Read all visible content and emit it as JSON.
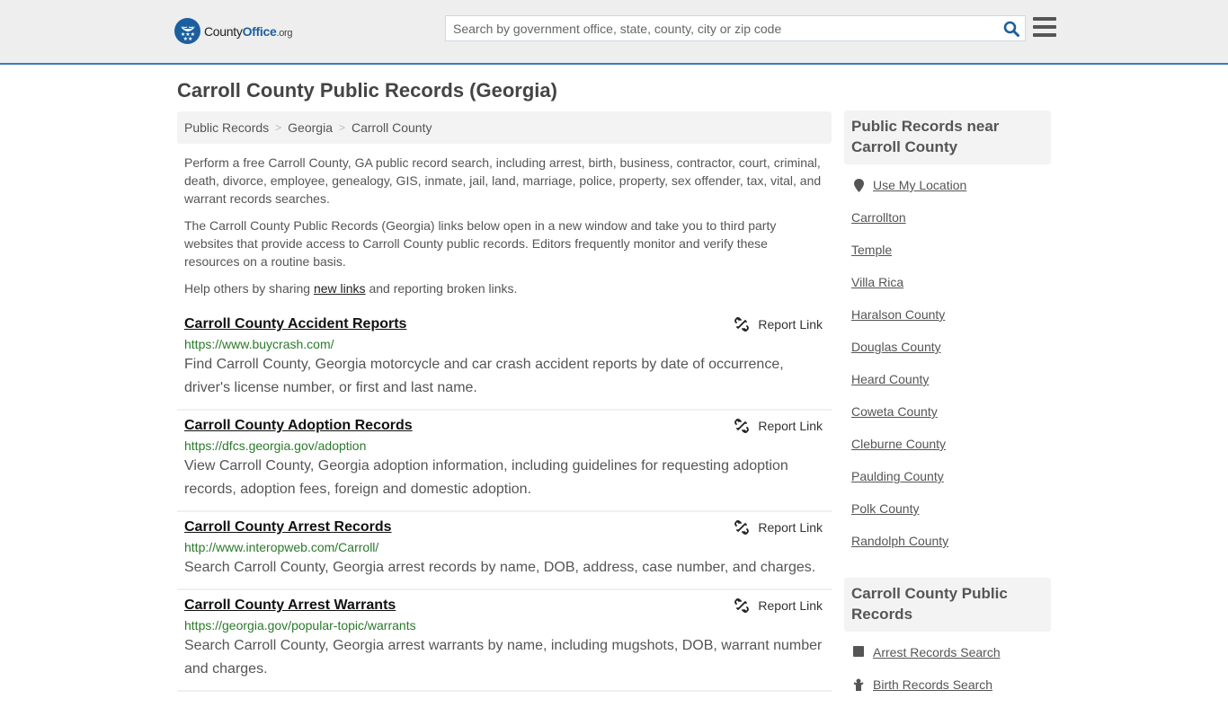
{
  "header": {
    "logo": {
      "county": "County",
      "office": "Office",
      "org": ".org"
    },
    "search": {
      "placeholder": "Search by government office, state, county, city or zip code",
      "value": ""
    },
    "brand_color": "#1b5f9e",
    "accent_line_color": "#3a7db4"
  },
  "page": {
    "title": "Carroll County Public Records (Georgia)"
  },
  "breadcrumb": [
    {
      "label": "Public Records"
    },
    {
      "label": "Georgia"
    },
    {
      "label": "Carroll County"
    }
  ],
  "breadcrumb_separator": ">",
  "intro": {
    "p1": "Perform a free Carroll County, GA public record search, including arrest, birth, business, contractor, court, criminal, death, divorce, employee, genealogy, GIS, inmate, jail, land, marriage, police, property, sex offender, tax, vital, and warrant records searches.",
    "p2": "The Carroll County Public Records (Georgia) links below open in a new window and take you to third party websites that provide access to Carroll County public records. Editors frequently monitor and verify these resources on a routine basis.",
    "p3_before": "Help others by sharing ",
    "p3_link": "new links",
    "p3_after": " and reporting broken links."
  },
  "report_label": "Report Link",
  "records": [
    {
      "title": "Carroll County Accident Reports",
      "url": "https://www.buycrash.com/",
      "description": "Find Carroll County, Georgia motorcycle and car crash accident reports by date of occurrence, driver's license number, or first and last name."
    },
    {
      "title": "Carroll County Adoption Records",
      "url": "https://dfcs.georgia.gov/adoption",
      "description": "View Carroll County, Georgia adoption information, including guidelines for requesting adoption records, adoption fees, foreign and domestic adoption."
    },
    {
      "title": "Carroll County Arrest Records",
      "url": "http://www.interopweb.com/Carroll/",
      "description": "Search Carroll County, Georgia arrest records by name, DOB, address, case number, and charges."
    },
    {
      "title": "Carroll County Arrest Warrants",
      "url": "https://georgia.gov/popular-topic/warrants",
      "description": "Search Carroll County, Georgia arrest warrants by name, including mugshots, DOB, warrant number and charges."
    }
  ],
  "sidebar": {
    "nearby_heading": "Public Records near Carroll County",
    "use_location": "Use My Location",
    "nearby": [
      "Carrollton",
      "Temple",
      "Villa Rica",
      "Haralson County",
      "Douglas County",
      "Heard County",
      "Coweta County",
      "Cleburne County",
      "Paulding County",
      "Polk County",
      "Randolph County"
    ],
    "records_heading": "Carroll County Public Records",
    "record_links": [
      {
        "label": "Arrest Records Search",
        "icon": "square-icon"
      },
      {
        "label": "Birth Records Search",
        "icon": "baby-icon"
      }
    ]
  }
}
